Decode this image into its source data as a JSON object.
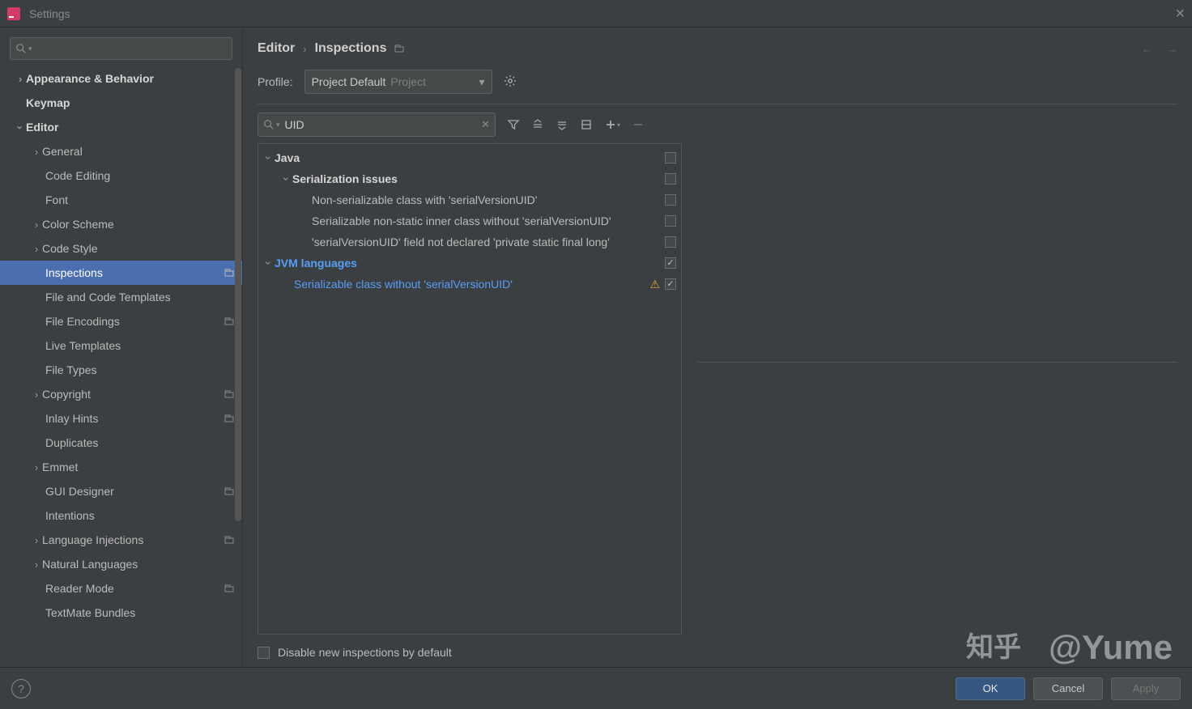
{
  "window": {
    "title": "Settings"
  },
  "sidebar": {
    "search_value": "",
    "items": [
      {
        "label": "Appearance & Behavior"
      },
      {
        "label": "Keymap"
      },
      {
        "label": "Editor"
      },
      {
        "label": "General"
      },
      {
        "label": "Code Editing"
      },
      {
        "label": "Font"
      },
      {
        "label": "Color Scheme"
      },
      {
        "label": "Code Style"
      },
      {
        "label": "Inspections"
      },
      {
        "label": "File and Code Templates"
      },
      {
        "label": "File Encodings"
      },
      {
        "label": "Live Templates"
      },
      {
        "label": "File Types"
      },
      {
        "label": "Copyright"
      },
      {
        "label": "Inlay Hints"
      },
      {
        "label": "Duplicates"
      },
      {
        "label": "Emmet"
      },
      {
        "label": "GUI Designer"
      },
      {
        "label": "Intentions"
      },
      {
        "label": "Language Injections"
      },
      {
        "label": "Natural Languages"
      },
      {
        "label": "Reader Mode"
      },
      {
        "label": "TextMate Bundles"
      }
    ]
  },
  "breadcrumb": {
    "root": "Editor",
    "current": "Inspections"
  },
  "profile": {
    "label": "Profile:",
    "name": "Project Default",
    "scope": "Project"
  },
  "search": {
    "value": "UID"
  },
  "inspections": {
    "java": {
      "label": "Java"
    },
    "serialization": {
      "label": "Serialization issues"
    },
    "item1": {
      "label": "Non-serializable class with 'serialVersionUID'"
    },
    "item2": {
      "label": "Serializable non-static inner class without 'serialVersionUID'"
    },
    "item3": {
      "label": "'serialVersionUID' field not declared 'private static final long'"
    },
    "jvm": {
      "label": "JVM languages"
    },
    "item4": {
      "label": "Serializable class without 'serialVersionUID'"
    }
  },
  "disable": {
    "label": "Disable new inspections by default"
  },
  "footer": {
    "ok": "OK",
    "cancel": "Cancel",
    "apply": "Apply"
  },
  "watermark": {
    "text": "@Yume"
  }
}
